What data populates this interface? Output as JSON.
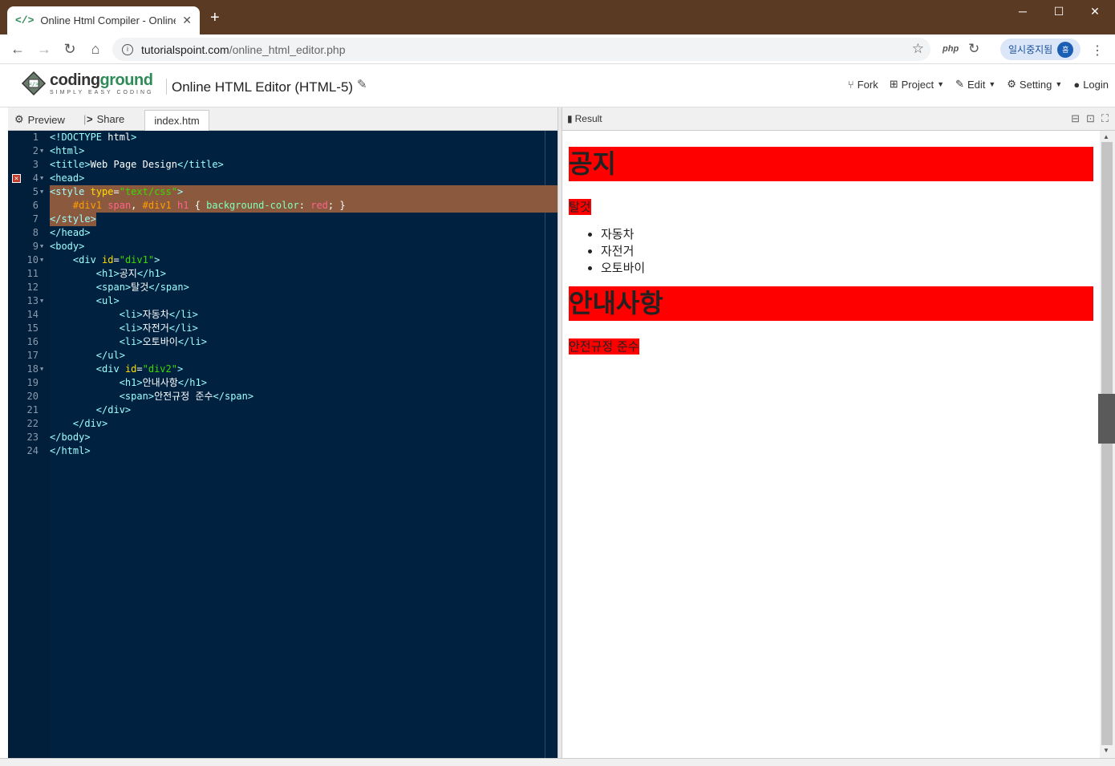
{
  "browser": {
    "tab_title": "Online Html Compiler - Online H",
    "tab_icon": "</>",
    "url_host": "tutorialspoint.com",
    "url_path": "/online_html_editor.php",
    "profile_label": "일시중지됨",
    "profile_initial": "흠",
    "ext_php": "php"
  },
  "site": {
    "logo_main_a": "coding",
    "logo_main_b": "ground",
    "logo_sub": "SIMPLY EASY CODING",
    "title": "Online HTML Editor (HTML-5)",
    "menu": {
      "fork": "Fork",
      "project": "Project",
      "edit": "Edit",
      "setting": "Setting",
      "login": "Login"
    }
  },
  "editor_toolbar": {
    "preview": "Preview",
    "share": "Share",
    "file_tab": "index.htm"
  },
  "code_lines": [
    "<!DOCTYPE html>",
    "<html>",
    "<title>Web Page Design</title>",
    "<head>",
    "<style type=\"text/css\">",
    "    #div1 span, #div1 h1 { background-color: red; }",
    "</style>",
    "</head>",
    "<body>",
    "    <div id=\"div1\">",
    "        <h1>공지</h1>",
    "        <span>탈것</span>",
    "        <ul>",
    "            <li>자동차</li>",
    "            <li>자전거</li>",
    "            <li>오토바이</li>",
    "        </ul>",
    "        <div id=\"div2\">",
    "            <h1>안내사항</h1>",
    "            <span>안전규정 준수</span>",
    "        </div>",
    "    </div>",
    "</body>",
    "</html>"
  ],
  "line_numbers": [
    "1",
    "2",
    "3",
    "4",
    "5",
    "6",
    "7",
    "8",
    "9",
    "10",
    "11",
    "12",
    "13",
    "14",
    "15",
    "16",
    "17",
    "18",
    "19",
    "20",
    "21",
    "22",
    "23",
    "24"
  ],
  "result": {
    "label": "Result",
    "h1_first": "공지",
    "span_first": "탈것",
    "list_items": [
      "자동차",
      "자전거",
      "오토바이"
    ],
    "h1_second": "안내사항",
    "span_second": "안전규정 준수"
  }
}
